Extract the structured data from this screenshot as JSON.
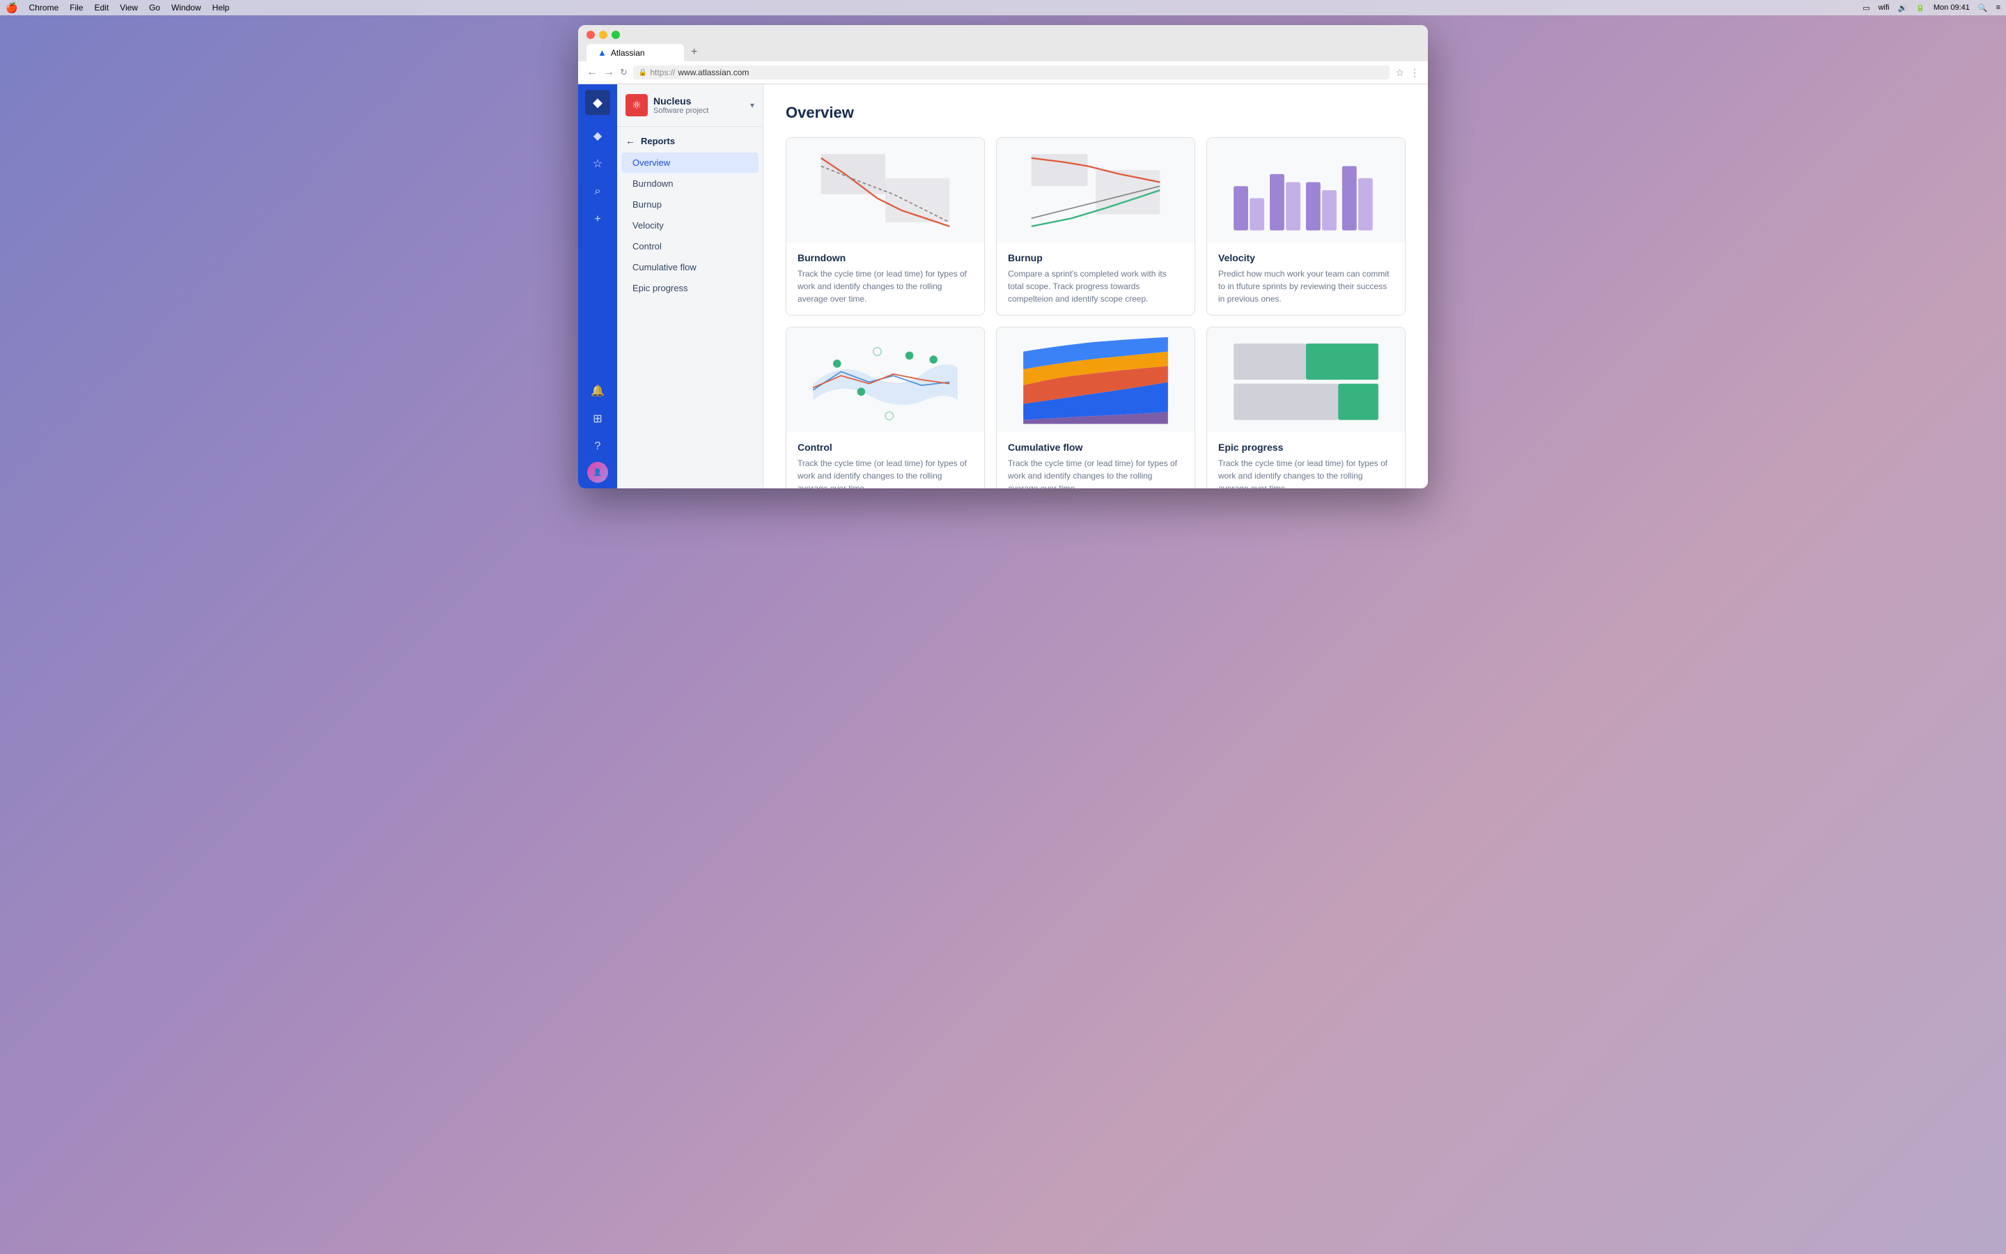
{
  "menubar": {
    "apple": "🍎",
    "items": [
      "Chrome",
      "File",
      "Edit",
      "View",
      "Go",
      "Window",
      "Help"
    ],
    "time": "Mon 09:41"
  },
  "browser": {
    "tab_label": "Atlassian",
    "url_protocol": "https://",
    "url_domain": "www.atlassian.com",
    "add_tab_label": "+"
  },
  "project": {
    "name": "Nucleus",
    "type": "Software project",
    "icon": "⚛"
  },
  "sidebar": {
    "section_label": "Reports",
    "items": [
      {
        "id": "overview",
        "label": "Overview",
        "active": true
      },
      {
        "id": "burndown",
        "label": "Burndown",
        "active": false
      },
      {
        "id": "burnup",
        "label": "Burnup",
        "active": false
      },
      {
        "id": "velocity",
        "label": "Velocity",
        "active": false
      },
      {
        "id": "control",
        "label": "Control",
        "active": false
      },
      {
        "id": "cumulative-flow",
        "label": "Cumulative flow",
        "active": false
      },
      {
        "id": "epic-progress",
        "label": "Epic progress",
        "active": false
      }
    ]
  },
  "main": {
    "page_title": "Overview",
    "cards": [
      {
        "id": "burndown",
        "title": "Burndown",
        "description": "Track the cycle time (or lead time) for types of work and identify changes to the rolling average over time.",
        "chart_type": "burndown"
      },
      {
        "id": "burnup",
        "title": "Burnup",
        "description": "Compare a sprint's completed work with its total scope. Track progress towards compelteion and identify scope creep.",
        "chart_type": "burnup"
      },
      {
        "id": "velocity",
        "title": "Velocity",
        "description": "Predict how much work your team can commit to in tfuture sprints by reviewing their success in previous ones.",
        "chart_type": "velocity"
      },
      {
        "id": "control",
        "title": "Control",
        "description": "Track the cycle time (or lead time) for types of work and identify changes to the rolling average over time.",
        "chart_type": "control"
      },
      {
        "id": "cumulative-flow",
        "title": "Cumulative flow",
        "description": "Track the cycle time (or lead time) for types of work and identify changes to the rolling average over time.",
        "chart_type": "cumulative"
      },
      {
        "id": "epic-progress",
        "title": "Epic progress",
        "description": "Track the cycle time (or lead time) for types of work and identify changes to the rolling average over time.",
        "chart_type": "epic"
      }
    ]
  },
  "nav": {
    "icons": [
      "◆",
      "☆",
      "🔍",
      "+"
    ],
    "bottom_icons": [
      "🔔",
      "⊞",
      "?"
    ]
  }
}
